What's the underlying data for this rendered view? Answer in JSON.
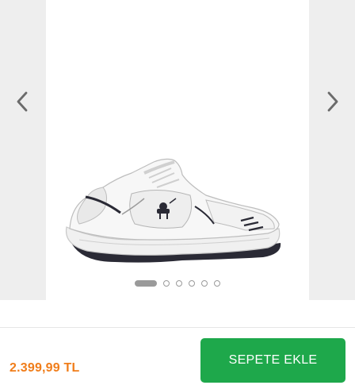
{
  "gallery": {
    "prev_icon": "chevron-left-icon",
    "next_icon": "chevron-right-icon",
    "product_image": "white-sneaker-image",
    "slide_count": 6,
    "active_slide": 1
  },
  "product": {
    "price": "2.399,99 TL",
    "price_color": "#f07d1a"
  },
  "actions": {
    "add_to_cart_label": "SEPETE EKLE",
    "button_color": "#1ea84b"
  }
}
